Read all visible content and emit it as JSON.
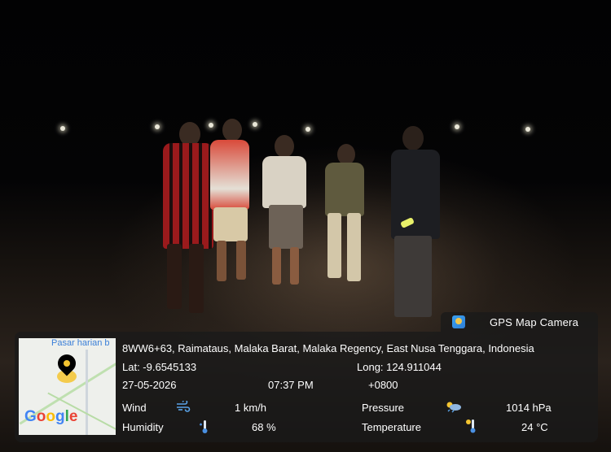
{
  "badge": {
    "title": "GPS Map Camera",
    "logo_icon": "gps-map-camera-app-icon"
  },
  "map": {
    "place_label": "Pasar harian b",
    "brand": [
      "G",
      "o",
      "o",
      "g",
      "l",
      "e"
    ]
  },
  "location": {
    "address": "8WW6+63, Raimataus, Malaka Barat, Malaka Regency, East Nusa Tenggara, Indonesia",
    "lat": "Lat: -9.6545133",
    "long": "Long: 124.911044",
    "date": "27-05-2026",
    "time": "07:37 PM",
    "tz": "+0800"
  },
  "weather": {
    "wind_label": "Wind",
    "wind_value": "1 km/h",
    "wind_icon": "wind-icon",
    "humidity_label": "Humidity",
    "humidity_value": "68 %",
    "humidity_icon": "humidity-icon",
    "pressure_label": "Pressure",
    "pressure_value": "1014 hPa",
    "pressure_icon": "pressure-icon",
    "temperature_label": "Temperature",
    "temperature_value": "24 °C",
    "temperature_icon": "thermometer-icon"
  }
}
